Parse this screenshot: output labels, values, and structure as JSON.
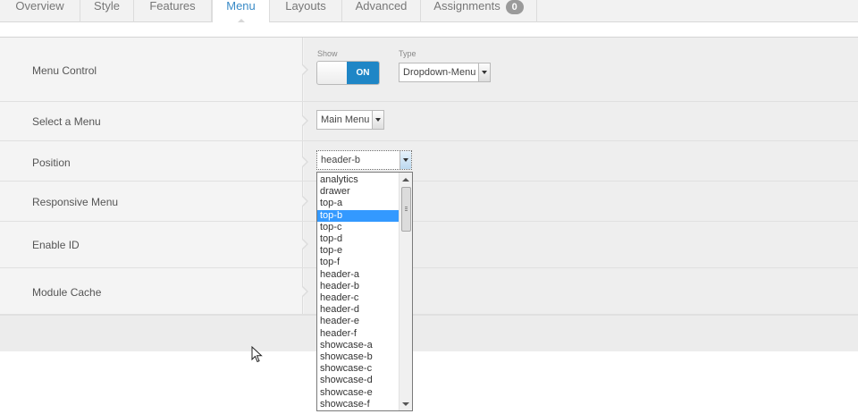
{
  "tabs": [
    {
      "label": "Overview"
    },
    {
      "label": "Style"
    },
    {
      "label": "Features"
    },
    {
      "label": "Menu"
    },
    {
      "label": "Layouts"
    },
    {
      "label": "Advanced"
    },
    {
      "label": "Assignments",
      "badge": "0"
    }
  ],
  "rows": {
    "menu_control": {
      "label": "Menu Control",
      "show_label": "Show",
      "toggle_value": "ON",
      "type_label": "Type",
      "type_value": "Dropdown-Menu"
    },
    "select_menu": {
      "label": "Select a Menu",
      "value": "Main Menu"
    },
    "position": {
      "label": "Position",
      "value": "header-b"
    },
    "responsive_menu": {
      "label": "Responsive Menu"
    },
    "enable_id": {
      "label": "Enable ID"
    },
    "module_cache": {
      "label": "Module Cache"
    }
  },
  "position_options": [
    "analytics",
    "drawer",
    "top-a",
    "top-b",
    "top-c",
    "top-d",
    "top-e",
    "top-f",
    "header-a",
    "header-b",
    "header-c",
    "header-d",
    "header-e",
    "header-f",
    "showcase-a",
    "showcase-b",
    "showcase-c",
    "showcase-d",
    "showcase-e",
    "showcase-f"
  ],
  "position_highlighted": "top-b",
  "colors": {
    "accent": "#1f86c6",
    "active_tab": "#3a8bc7",
    "highlight": "#3399ff"
  }
}
